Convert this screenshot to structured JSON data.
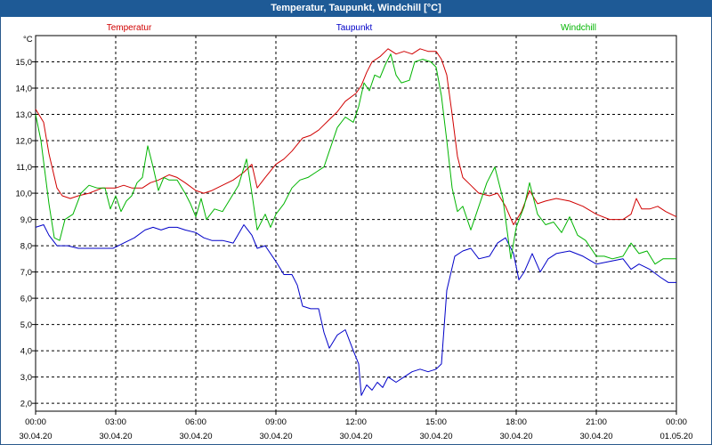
{
  "window": {
    "title": "Temperatur, Taupunkt, Windchill [°C]"
  },
  "chart_data": {
    "type": "line",
    "title": "Temperatur, Taupunkt, Windchill [°C]",
    "ylabel": "°C",
    "ylim": [
      1.7,
      16.0
    ],
    "yticks": [
      2.0,
      3.0,
      4.0,
      5.0,
      6.0,
      7.0,
      8.0,
      9.0,
      10.0,
      11.0,
      12.0,
      13.0,
      14.0,
      15.0
    ],
    "ytick_labels": [
      "2,0",
      "3,0",
      "4,0",
      "5,0",
      "6,0",
      "7,0",
      "8,0",
      "9,0",
      "10,0",
      "11,0",
      "12,0",
      "13,0",
      "14,0",
      "15,0"
    ],
    "x_range_hours": [
      0,
      24
    ],
    "xticks": [
      {
        "h": 0,
        "time": "00:00",
        "date": "30.04.20"
      },
      {
        "h": 3,
        "time": "03:00",
        "date": "30.04.20"
      },
      {
        "h": 6,
        "time": "06:00",
        "date": "30.04.20"
      },
      {
        "h": 9,
        "time": "09:00",
        "date": "30.04.20"
      },
      {
        "h": 12,
        "time": "12:00",
        "date": "30.04.20"
      },
      {
        "h": 15,
        "time": "15:00",
        "date": "30.04.20"
      },
      {
        "h": 18,
        "time": "18:00",
        "date": "30.04.20"
      },
      {
        "h": 21,
        "time": "21:00",
        "date": "30.04.20"
      },
      {
        "h": 24,
        "time": "00:00",
        "date": "01.05.20"
      }
    ],
    "grid": true,
    "legend_position": "top",
    "series": [
      {
        "name": "Temperatur",
        "color": "#d00000",
        "points": [
          [
            0,
            13.2
          ],
          [
            0.3,
            12.7
          ],
          [
            0.5,
            11.5
          ],
          [
            0.8,
            10.2
          ],
          [
            1.0,
            9.9
          ],
          [
            1.3,
            9.8
          ],
          [
            1.6,
            9.9
          ],
          [
            2.0,
            10.0
          ],
          [
            2.5,
            10.2
          ],
          [
            3.0,
            10.2
          ],
          [
            3.3,
            10.3
          ],
          [
            3.6,
            10.2
          ],
          [
            4.0,
            10.2
          ],
          [
            4.3,
            10.4
          ],
          [
            4.6,
            10.5
          ],
          [
            5.0,
            10.7
          ],
          [
            5.3,
            10.6
          ],
          [
            5.6,
            10.4
          ],
          [
            6.0,
            10.1
          ],
          [
            6.3,
            10.0
          ],
          [
            6.6,
            10.1
          ],
          [
            7.0,
            10.3
          ],
          [
            7.4,
            10.5
          ],
          [
            7.8,
            10.8
          ],
          [
            8.1,
            11.1
          ],
          [
            8.3,
            10.2
          ],
          [
            8.6,
            10.6
          ],
          [
            9.0,
            11.1
          ],
          [
            9.3,
            11.3
          ],
          [
            9.6,
            11.6
          ],
          [
            10.0,
            12.1
          ],
          [
            10.3,
            12.2
          ],
          [
            10.6,
            12.4
          ],
          [
            11.0,
            12.8
          ],
          [
            11.3,
            13.1
          ],
          [
            11.6,
            13.5
          ],
          [
            12.0,
            13.8
          ],
          [
            12.2,
            14.1
          ],
          [
            12.4,
            14.6
          ],
          [
            12.6,
            15.0
          ],
          [
            12.9,
            15.2
          ],
          [
            13.2,
            15.5
          ],
          [
            13.5,
            15.3
          ],
          [
            13.8,
            15.4
          ],
          [
            14.1,
            15.3
          ],
          [
            14.4,
            15.5
          ],
          [
            14.7,
            15.4
          ],
          [
            15.0,
            15.4
          ],
          [
            15.2,
            15.1
          ],
          [
            15.4,
            14.5
          ],
          [
            15.6,
            13.0
          ],
          [
            15.8,
            11.4
          ],
          [
            16.0,
            10.6
          ],
          [
            16.3,
            10.3
          ],
          [
            16.6,
            10.0
          ],
          [
            17.0,
            9.9
          ],
          [
            17.3,
            10.0
          ],
          [
            17.6,
            9.5
          ],
          [
            17.9,
            8.8
          ],
          [
            18.2,
            9.3
          ],
          [
            18.5,
            10.1
          ],
          [
            18.8,
            9.6
          ],
          [
            19.1,
            9.7
          ],
          [
            19.5,
            9.8
          ],
          [
            20.0,
            9.7
          ],
          [
            20.5,
            9.5
          ],
          [
            21.0,
            9.2
          ],
          [
            21.5,
            9.0
          ],
          [
            22.0,
            9.0
          ],
          [
            22.3,
            9.2
          ],
          [
            22.5,
            9.8
          ],
          [
            22.7,
            9.4
          ],
          [
            23.0,
            9.4
          ],
          [
            23.3,
            9.5
          ],
          [
            23.6,
            9.3
          ],
          [
            24.0,
            9.1
          ]
        ]
      },
      {
        "name": "Taupunkt",
        "color": "#0000c8",
        "points": [
          [
            0,
            8.7
          ],
          [
            0.3,
            8.8
          ],
          [
            0.5,
            8.4
          ],
          [
            0.8,
            8.0
          ],
          [
            1.2,
            8.0
          ],
          [
            1.6,
            7.9
          ],
          [
            2.0,
            7.9
          ],
          [
            2.5,
            7.9
          ],
          [
            2.9,
            7.9
          ],
          [
            3.3,
            8.1
          ],
          [
            3.7,
            8.3
          ],
          [
            4.1,
            8.6
          ],
          [
            4.4,
            8.7
          ],
          [
            4.7,
            8.6
          ],
          [
            5.0,
            8.7
          ],
          [
            5.3,
            8.7
          ],
          [
            5.6,
            8.6
          ],
          [
            6.0,
            8.5
          ],
          [
            6.3,
            8.3
          ],
          [
            6.6,
            8.2
          ],
          [
            7.0,
            8.2
          ],
          [
            7.4,
            8.1
          ],
          [
            7.8,
            8.8
          ],
          [
            8.1,
            8.4
          ],
          [
            8.3,
            7.9
          ],
          [
            8.6,
            8.0
          ],
          [
            9.0,
            7.4
          ],
          [
            9.3,
            6.9
          ],
          [
            9.6,
            6.9
          ],
          [
            9.8,
            6.5
          ],
          [
            10.0,
            5.7
          ],
          [
            10.3,
            5.6
          ],
          [
            10.6,
            5.6
          ],
          [
            10.8,
            4.7
          ],
          [
            11.0,
            4.1
          ],
          [
            11.3,
            4.6
          ],
          [
            11.6,
            4.8
          ],
          [
            11.9,
            4.0
          ],
          [
            12.1,
            3.5
          ],
          [
            12.2,
            2.3
          ],
          [
            12.4,
            2.7
          ],
          [
            12.6,
            2.5
          ],
          [
            12.8,
            2.8
          ],
          [
            13.0,
            2.6
          ],
          [
            13.2,
            3.0
          ],
          [
            13.5,
            2.8
          ],
          [
            13.8,
            3.0
          ],
          [
            14.1,
            3.2
          ],
          [
            14.4,
            3.3
          ],
          [
            14.7,
            3.2
          ],
          [
            15.0,
            3.3
          ],
          [
            15.2,
            3.5
          ],
          [
            15.4,
            6.3
          ],
          [
            15.7,
            7.6
          ],
          [
            16.0,
            7.8
          ],
          [
            16.3,
            7.9
          ],
          [
            16.6,
            7.5
          ],
          [
            17.0,
            7.6
          ],
          [
            17.3,
            8.1
          ],
          [
            17.6,
            8.3
          ],
          [
            17.9,
            7.7
          ],
          [
            18.1,
            6.7
          ],
          [
            18.3,
            7.0
          ],
          [
            18.6,
            7.7
          ],
          [
            18.9,
            7.0
          ],
          [
            19.2,
            7.5
          ],
          [
            19.5,
            7.7
          ],
          [
            20.0,
            7.8
          ],
          [
            20.5,
            7.6
          ],
          [
            21.0,
            7.3
          ],
          [
            21.5,
            7.4
          ],
          [
            22.0,
            7.5
          ],
          [
            22.3,
            7.1
          ],
          [
            22.6,
            7.3
          ],
          [
            23.0,
            7.1
          ],
          [
            23.4,
            6.8
          ],
          [
            23.7,
            6.6
          ],
          [
            24.0,
            6.6
          ]
        ]
      },
      {
        "name": "Windchill",
        "color": "#00b400",
        "points": [
          [
            0,
            13.0
          ],
          [
            0.2,
            12.0
          ],
          [
            0.5,
            9.6
          ],
          [
            0.7,
            8.3
          ],
          [
            0.9,
            8.2
          ],
          [
            1.1,
            9.0
          ],
          [
            1.4,
            9.2
          ],
          [
            1.7,
            10.0
          ],
          [
            2.0,
            10.3
          ],
          [
            2.3,
            10.2
          ],
          [
            2.6,
            10.2
          ],
          [
            2.8,
            9.4
          ],
          [
            3.0,
            9.9
          ],
          [
            3.2,
            9.3
          ],
          [
            3.4,
            9.7
          ],
          [
            3.6,
            9.9
          ],
          [
            3.8,
            10.4
          ],
          [
            4.0,
            10.6
          ],
          [
            4.2,
            11.8
          ],
          [
            4.4,
            11.0
          ],
          [
            4.6,
            10.1
          ],
          [
            4.8,
            10.6
          ],
          [
            5.0,
            10.5
          ],
          [
            5.3,
            10.5
          ],
          [
            5.6,
            10.0
          ],
          [
            5.8,
            9.6
          ],
          [
            6.0,
            9.1
          ],
          [
            6.2,
            9.8
          ],
          [
            6.4,
            9.0
          ],
          [
            6.7,
            9.4
          ],
          [
            7.0,
            9.3
          ],
          [
            7.3,
            9.8
          ],
          [
            7.6,
            10.3
          ],
          [
            7.9,
            11.3
          ],
          [
            8.1,
            10.0
          ],
          [
            8.3,
            8.6
          ],
          [
            8.6,
            9.2
          ],
          [
            8.8,
            8.7
          ],
          [
            9.0,
            9.2
          ],
          [
            9.3,
            9.6
          ],
          [
            9.6,
            10.2
          ],
          [
            9.9,
            10.5
          ],
          [
            10.2,
            10.6
          ],
          [
            10.5,
            10.8
          ],
          [
            10.8,
            11.0
          ],
          [
            11.0,
            11.6
          ],
          [
            11.3,
            12.5
          ],
          [
            11.6,
            12.9
          ],
          [
            11.9,
            12.7
          ],
          [
            12.1,
            13.3
          ],
          [
            12.3,
            14.2
          ],
          [
            12.5,
            13.9
          ],
          [
            12.7,
            14.5
          ],
          [
            12.9,
            14.4
          ],
          [
            13.1,
            14.9
          ],
          [
            13.3,
            15.3
          ],
          [
            13.5,
            14.5
          ],
          [
            13.7,
            14.2
          ],
          [
            14.0,
            14.3
          ],
          [
            14.2,
            15.0
          ],
          [
            14.5,
            15.1
          ],
          [
            14.8,
            15.0
          ],
          [
            15.0,
            14.8
          ],
          [
            15.2,
            13.7
          ],
          [
            15.4,
            12.0
          ],
          [
            15.6,
            10.2
          ],
          [
            15.8,
            9.3
          ],
          [
            16.0,
            9.5
          ],
          [
            16.3,
            8.6
          ],
          [
            16.6,
            9.5
          ],
          [
            16.9,
            10.4
          ],
          [
            17.2,
            11.0
          ],
          [
            17.5,
            9.8
          ],
          [
            17.8,
            7.5
          ],
          [
            18.0,
            8.7
          ],
          [
            18.3,
            9.5
          ],
          [
            18.5,
            10.4
          ],
          [
            18.8,
            9.2
          ],
          [
            19.1,
            8.8
          ],
          [
            19.4,
            8.9
          ],
          [
            19.7,
            8.5
          ],
          [
            20.0,
            9.1
          ],
          [
            20.3,
            8.4
          ],
          [
            20.6,
            8.2
          ],
          [
            21.0,
            7.6
          ],
          [
            21.3,
            7.6
          ],
          [
            21.6,
            7.5
          ],
          [
            22.0,
            7.6
          ],
          [
            22.3,
            8.1
          ],
          [
            22.6,
            7.7
          ],
          [
            22.9,
            7.8
          ],
          [
            23.2,
            7.3
          ],
          [
            23.5,
            7.5
          ],
          [
            23.8,
            7.5
          ],
          [
            24.0,
            7.5
          ]
        ]
      }
    ]
  }
}
